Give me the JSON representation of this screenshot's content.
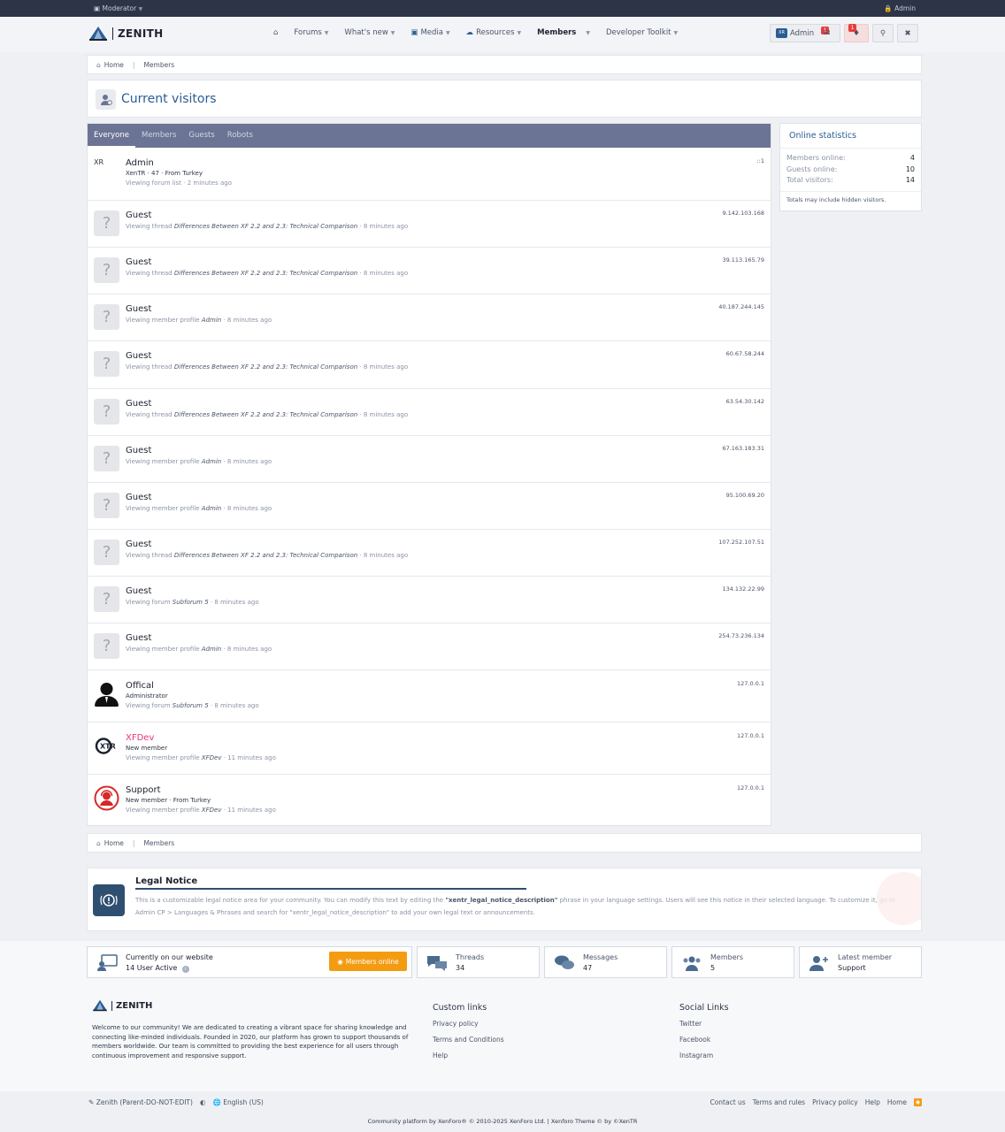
{
  "topbar": {
    "left_label": "Moderator",
    "right_label": "Admin"
  },
  "header": {
    "brand": "ZENITH",
    "nav": [
      {
        "label": "",
        "has_caret": false
      },
      {
        "label": "Forums",
        "has_caret": true
      },
      {
        "label": "What's new",
        "has_caret": true
      },
      {
        "label": "Media",
        "has_caret": true
      },
      {
        "label": "Resources",
        "has_caret": true
      },
      {
        "label": "Members",
        "has_caret": true,
        "active": true
      },
      {
        "label": "Developer Toolkit",
        "has_caret": true
      }
    ],
    "user_label": "Admin",
    "inbox_badge": "1",
    "alerts_badge": "1"
  },
  "breadcrumb": {
    "home": "Home",
    "current": "Members"
  },
  "page_title": "Current visitors",
  "tabs": [
    "Everyone",
    "Members",
    "Guests",
    "Robots"
  ],
  "visitors": [
    {
      "name": "Admin",
      "sub": "XenTR · 47 · From Turkey",
      "activity_prefix": "Viewing forum list · 2 minutes ago",
      "activity_link": "",
      "activity_suffix": "",
      "ip": "::1",
      "avatar": "xr"
    },
    {
      "name": "Guest",
      "sub": "",
      "activity_prefix": "Viewing thread ",
      "activity_link": "Differences Between XF 2.2 and 2.3: Technical Comparison",
      "activity_suffix": " · 8 minutes ago",
      "ip": "9.142.103.168",
      "avatar": "guest"
    },
    {
      "name": "Guest",
      "sub": "",
      "activity_prefix": "Viewing thread ",
      "activity_link": "Differences Between XF 2.2 and 2.3: Technical Comparison",
      "activity_suffix": " · 8 minutes ago",
      "ip": "39.113.165.79",
      "avatar": "guest"
    },
    {
      "name": "Guest",
      "sub": "",
      "activity_prefix": "Viewing member profile ",
      "activity_link": "Admin",
      "activity_suffix": " · 8 minutes ago",
      "ip": "40.187.244.145",
      "avatar": "guest"
    },
    {
      "name": "Guest",
      "sub": "",
      "activity_prefix": "Viewing thread ",
      "activity_link": "Differences Between XF 2.2 and 2.3: Technical Comparison",
      "activity_suffix": " · 8 minutes ago",
      "ip": "60.67.58.244",
      "avatar": "guest"
    },
    {
      "name": "Guest",
      "sub": "",
      "activity_prefix": "Viewing thread ",
      "activity_link": "Differences Between XF 2.2 and 2.3: Technical Comparison",
      "activity_suffix": " · 8 minutes ago",
      "ip": "63.54.30.142",
      "avatar": "guest"
    },
    {
      "name": "Guest",
      "sub": "",
      "activity_prefix": "Viewing member profile ",
      "activity_link": "Admin",
      "activity_suffix": " · 8 minutes ago",
      "ip": "67.163.183.31",
      "avatar": "guest"
    },
    {
      "name": "Guest",
      "sub": "",
      "activity_prefix": "Viewing member profile ",
      "activity_link": "Admin",
      "activity_suffix": " · 8 minutes ago",
      "ip": "95.100.69.20",
      "avatar": "guest"
    },
    {
      "name": "Guest",
      "sub": "",
      "activity_prefix": "Viewing thread ",
      "activity_link": "Differences Between XF 2.2 and 2.3: Technical Comparison",
      "activity_suffix": " · 8 minutes ago",
      "ip": "107.252.107.51",
      "avatar": "guest"
    },
    {
      "name": "Guest",
      "sub": "",
      "activity_prefix": "Viewing forum ",
      "activity_link": "Subforum 5",
      "activity_suffix": " · 8 minutes ago",
      "ip": "134.132.22.99",
      "avatar": "guest"
    },
    {
      "name": "Guest",
      "sub": "",
      "activity_prefix": "Viewing member profile ",
      "activity_link": "Admin",
      "activity_suffix": " · 8 minutes ago",
      "ip": "254.73.236.134",
      "avatar": "guest"
    },
    {
      "name": "Offical",
      "sub": "Administrator",
      "activity_prefix": "Viewing forum ",
      "activity_link": "Subforum 5",
      "activity_suffix": " · 8 minutes ago",
      "ip": "127.0.0.1",
      "avatar": "person"
    },
    {
      "name": "XFDev",
      "sub": "New member",
      "activity_prefix": "Viewing member profile ",
      "activity_link": "XFDev",
      "activity_suffix": " · 11 minutes ago",
      "ip": "127.0.0.1",
      "avatar": "xtr",
      "pink": true
    },
    {
      "name": "Support",
      "sub": "New member · From Turkey",
      "activity_prefix": "Viewing member profile ",
      "activity_link": "XFDev",
      "activity_suffix": " · 11 minutes ago",
      "ip": "127.0.0.1",
      "avatar": "support"
    }
  ],
  "online_stats": {
    "title": "Online statistics",
    "rows": [
      {
        "label": "Members online:",
        "value": "4"
      },
      {
        "label": "Guests online:",
        "value": "10"
      },
      {
        "label": "Total visitors:",
        "value": "14"
      }
    ],
    "footnote": "Totals may include hidden visitors."
  },
  "legal": {
    "title": "Legal Notice",
    "text_1": "This is a customizable legal notice area for your community. You can modify this text by editing the ",
    "text_bold_1": "\"xentr_legal_notice_description\"",
    "text_2": " phrase in your language settings. Users will see this notice in their selected language. To customize it, go to Admin CP > Languages & Phrases and search for \"xentr_legal_notice_description\" to add your own legal text or announcements."
  },
  "stats_bar": {
    "current_label": "Currently on our website",
    "current_value": "14 User Active",
    "members_online_button": "Members online",
    "items": [
      {
        "label": "Threads",
        "value": "34"
      },
      {
        "label": "Messages",
        "value": "47"
      },
      {
        "label": "Members",
        "value": "5"
      },
      {
        "label": "Latest member",
        "value": "Support"
      }
    ]
  },
  "footer": {
    "brand": "ZENITH",
    "description": "Welcome to our community! We are dedicated to creating a vibrant space for sharing knowledge and connecting like-minded individuals. Founded in 2020, our platform has grown to support thousands of members worldwide. Our team is committed to providing the best experience for all users through continuous improvement and responsive support.",
    "custom_links_title": "Custom links",
    "custom_links": [
      "Privacy policy",
      "Terms and Conditions",
      "Help"
    ],
    "social_title": "Social Links",
    "social_links": [
      "Twitter",
      "Facebook",
      "Instagram"
    ],
    "style_label": "Zenith (Parent-DO-NOT-EDIT)",
    "language_label": "English (US)",
    "bottom_links": [
      "Contact us",
      "Terms and rules",
      "Privacy policy",
      "Help",
      "Home"
    ],
    "copyright": "Community platform by XenForo® © 2010-2025 XenForo Ltd. | Xenforo Theme © by ©XenTR"
  }
}
